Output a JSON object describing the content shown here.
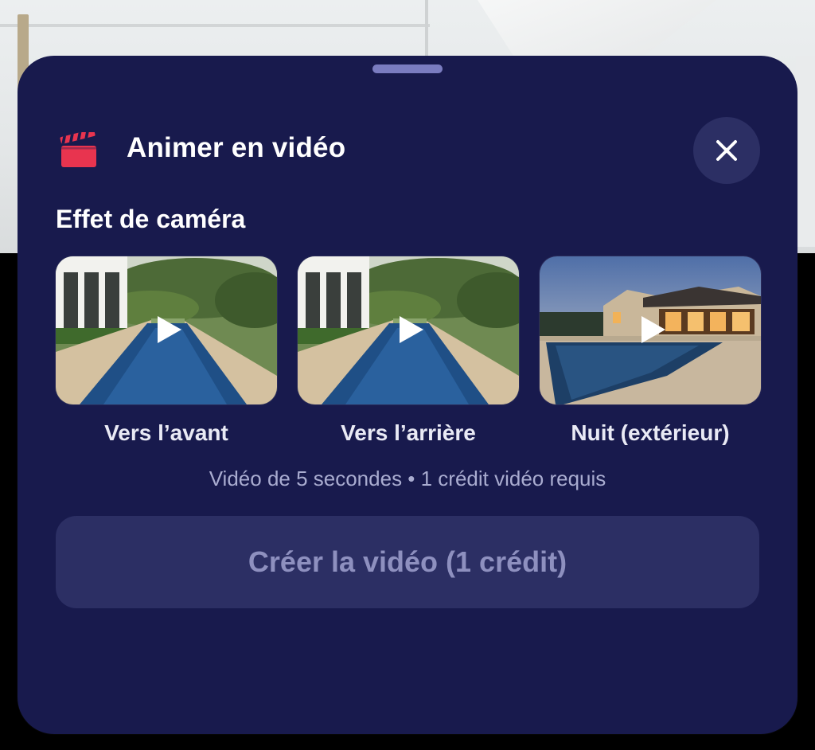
{
  "sheet": {
    "title": "Animer en vidéo",
    "section_label": "Effet de caméra",
    "options": [
      {
        "label": "Vers l’avant",
        "icon": "play-icon"
      },
      {
        "label": "Vers l’arrière",
        "icon": "play-icon"
      },
      {
        "label": "Nuit (extérieur)",
        "icon": "play-icon"
      }
    ],
    "info": "Vidéo de 5 secondes • 1 crédit vidéo requis",
    "create_label": "Créer la vidéo (1 crédit)"
  },
  "colors": {
    "sheet_bg": "#181a4d",
    "accent_icon": "#e8344f",
    "button_bg": "#2c2f64",
    "button_text_disabled": "#8e90bf"
  }
}
